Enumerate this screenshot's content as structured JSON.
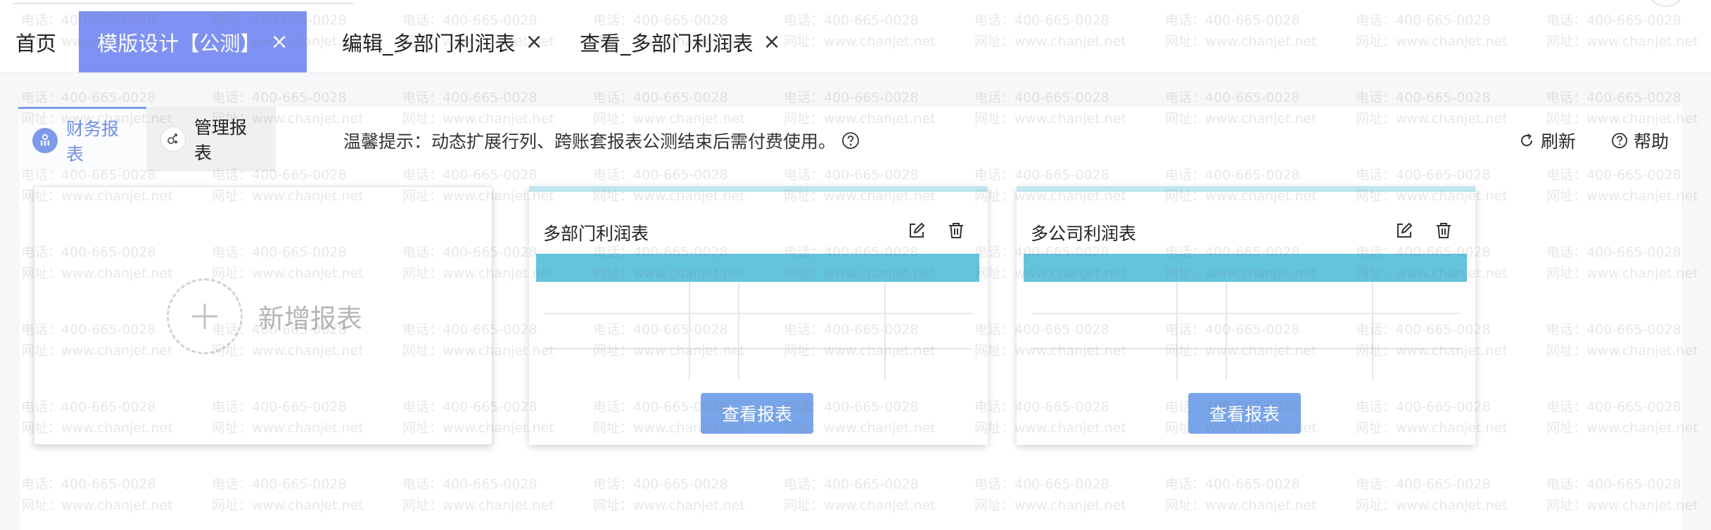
{
  "tabs": {
    "home": "首页",
    "active": "模版设计【公测】",
    "edit": "编辑_多部门利润表",
    "view": "查看_多部门利润表",
    "close_symbol": "×"
  },
  "report_types": {
    "finance": "财务报表",
    "manage": "管理报表"
  },
  "notice": {
    "text": "温馨提示：动态扩展行列、跨账套报表公测结束后需付费使用。"
  },
  "toolbar": {
    "refresh": "刷新",
    "help": "帮助"
  },
  "add_card": {
    "label": "新增报表"
  },
  "reports": [
    {
      "title": "多部门利润表",
      "button": "查看报表"
    },
    {
      "title": "多公司利润表",
      "button": "查看报表"
    }
  ],
  "watermark": {
    "phone": "电话：400-665-0028",
    "site": "网址：www.chanjet.net"
  },
  "colors": {
    "active_tab": "#7f92f4",
    "finance_accent": "#6f8fe6",
    "preview_band": "#63c4dc",
    "view_button": "#78a4ea"
  },
  "icons": {
    "tab_close": "close-icon",
    "finance": "finance-report-icon",
    "manage": "manage-report-icon",
    "notice_help": "question-circle-icon",
    "refresh": "refresh-icon",
    "help": "help-icon",
    "add": "plus-icon",
    "edit": "edit-icon",
    "delete": "trash-icon"
  }
}
